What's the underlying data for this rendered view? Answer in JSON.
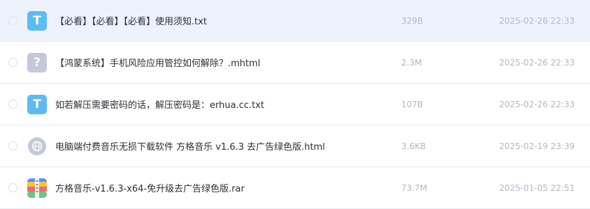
{
  "files": [
    {
      "name": "【必看】【必看】【必看】使用须知.txt",
      "size": "329B",
      "date": "2025-02-26 22:33",
      "icon": "txt-file-icon",
      "icon_glyph": "T"
    },
    {
      "name": "【鸿蒙系统】手机风险应用管控如何解除？.mhtml",
      "size": "2.3M",
      "date": "2025-02-26 22:33",
      "icon": "unknown-file-icon",
      "icon_glyph": "?"
    },
    {
      "name": "如若解压需要密码的话，解压密码是：erhua.cc.txt",
      "size": "107B",
      "date": "2025-02-26 22:33",
      "icon": "txt-file-icon",
      "icon_glyph": "T"
    },
    {
      "name": "电脑端付费音乐无损下载软件 方格音乐 v1.6.3 去广告绿色版.html",
      "size": "3.6KB",
      "date": "2025-02-19 23:39",
      "icon": "html-file-icon"
    },
    {
      "name": "方格音乐-v1.6.3-x64-免升级去广告绿色版.rar",
      "size": "73.7M",
      "date": "2025-01-05 22:51",
      "icon": "rar-archive-icon"
    }
  ],
  "colors": {
    "hover_row": "#eef2fd",
    "txt_icon": "#5cbbf6",
    "unknown_icon": "#c3c9d8",
    "meta_text": "#b3b8c2",
    "name_text": "#2b2f36"
  }
}
